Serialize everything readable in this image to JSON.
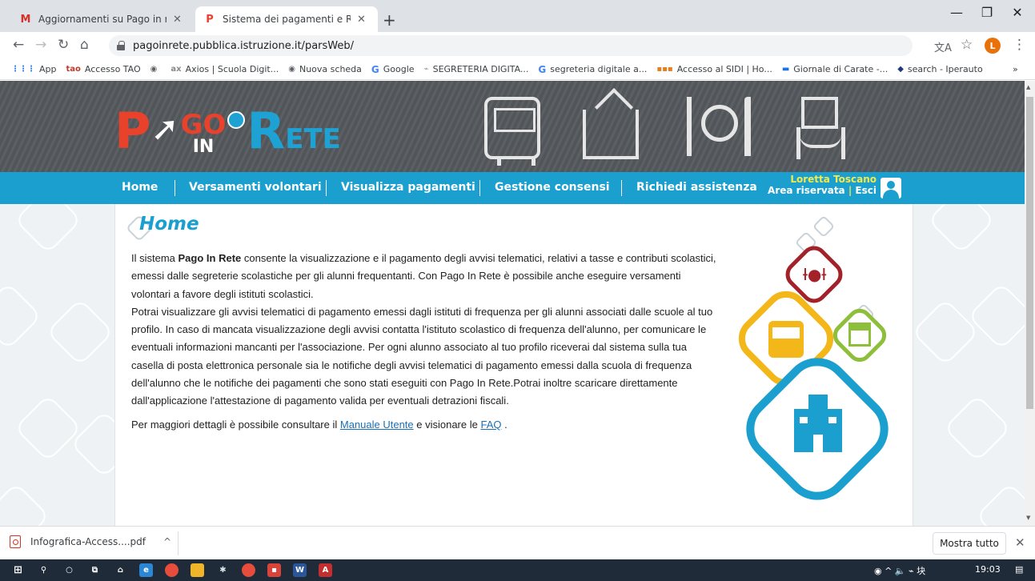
{
  "browser": {
    "tabs": [
      {
        "title": "Aggiornamenti su Pago in rete -",
        "favicon": "gmail-icon"
      },
      {
        "title": "Sistema dei pagamenti e Riconcil",
        "favicon": "pagoinrete-icon"
      }
    ],
    "new_tab": "+",
    "window_controls": {
      "minimize": "—",
      "restore": "❐",
      "close": "✕"
    },
    "url": "pagoinrete.pubblica.istruzione.it/parsWeb/",
    "profile_initial": "L",
    "bookmarks": [
      {
        "label": "App",
        "icon": "apps-grid-icon"
      },
      {
        "label": "Accesso TAO",
        "icon": "tao-icon"
      },
      {
        "label": "",
        "icon": "globe-icon"
      },
      {
        "label": "Axios | Scuola Digit...",
        "icon": "axios-icon"
      },
      {
        "label": "Nuova scheda",
        "icon": "globe-icon"
      },
      {
        "label": "Google",
        "icon": "google-icon"
      },
      {
        "label": "SEGRETERIA DIGITA...",
        "icon": "segreteria-icon"
      },
      {
        "label": "segreteria digitale a...",
        "icon": "google-icon"
      },
      {
        "label": "Accesso al SIDI | Ho...",
        "icon": "sidi-icon"
      },
      {
        "label": "Giornale di Carate -...",
        "icon": "giornale-icon"
      },
      {
        "label": "search - Iperauto",
        "icon": "iperauto-icon"
      }
    ],
    "bookmarks_more": "»"
  },
  "site": {
    "logo": {
      "p": "P",
      "go": "GO",
      "in": "IN",
      "r": "R",
      "ete": "ETE"
    },
    "nav": [
      {
        "label": "Home"
      },
      {
        "label": "Versamenti volontari"
      },
      {
        "label": "Visualizza pagamenti"
      },
      {
        "label": "Gestione consensi"
      },
      {
        "label": "Richiedi assistenza"
      }
    ],
    "user": {
      "name": "Loretta Toscano",
      "area": "Area riservata",
      "separator": "|",
      "logout": "Esci"
    },
    "colors": {
      "nav_bg": "#1a9fce",
      "user_name": "#f5e94a",
      "heading": "#1a9fce",
      "logo_red": "#e8412c"
    }
  },
  "main": {
    "title": "Home",
    "p1_pre": "Il sistema ",
    "p1_bold": "Pago In Rete",
    "p1_post": " consente la visualizzazione e il pagamento degli avvisi telematici, relativi a tasse e contributi scolastici, emessi dalle segreterie scolastiche per gli alunni frequentanti. Con Pago In Rete è possibile anche eseguire versamenti volontari a favore degli istituti scolastici.",
    "p2": "Potrai visualizzare gli avvisi telematici di pagamento emessi dagli istituti di frequenza per gli alunni associati dalle scuole al tuo profilo. In caso di mancata visualizzazione degli avvisi contatta l'istituto scolastico di frequenza dell'alunno, per comunicare le eventuali informazioni mancanti per l'associazione. Per ogni alunno associato al tuo profilo riceverai dal sistema sulla tua casella di posta elettronica personale sia le notifiche degli avvisi telematici di pagamento emessi dalla scuola di frequenza dell'alunno che le notifiche dei pagamenti che sono stati eseguiti con Pago In Rete.Potrai inoltre scaricare direttamente dall'applicazione l'attestazione di pagamento valida per eventuali detrazioni fiscali.",
    "more_pre": "Per maggiori dettagli è possibile consultare il ",
    "manual_link": "Manuale Utente",
    "more_mid": " e visionare le ",
    "faq_link": "FAQ",
    "more_post": " ."
  },
  "downloads": {
    "file": "Infografica-Access....pdf",
    "expand": "^",
    "show_all": "Mostra tutto",
    "close": "✕"
  },
  "taskbar": {
    "icons": [
      "windows-start-icon",
      "search-icon",
      "cortana-icon",
      "task-view-icon",
      "store-icon",
      "edge-icon",
      "chrome-icon",
      "file-explorer-icon",
      "teams-icon",
      "opera-icon",
      "presentation-icon",
      "word-icon",
      "acrobat-icon"
    ],
    "time": "19:03",
    "tray_symbols": "◉ ^ 🔈 ⌁ 块"
  }
}
